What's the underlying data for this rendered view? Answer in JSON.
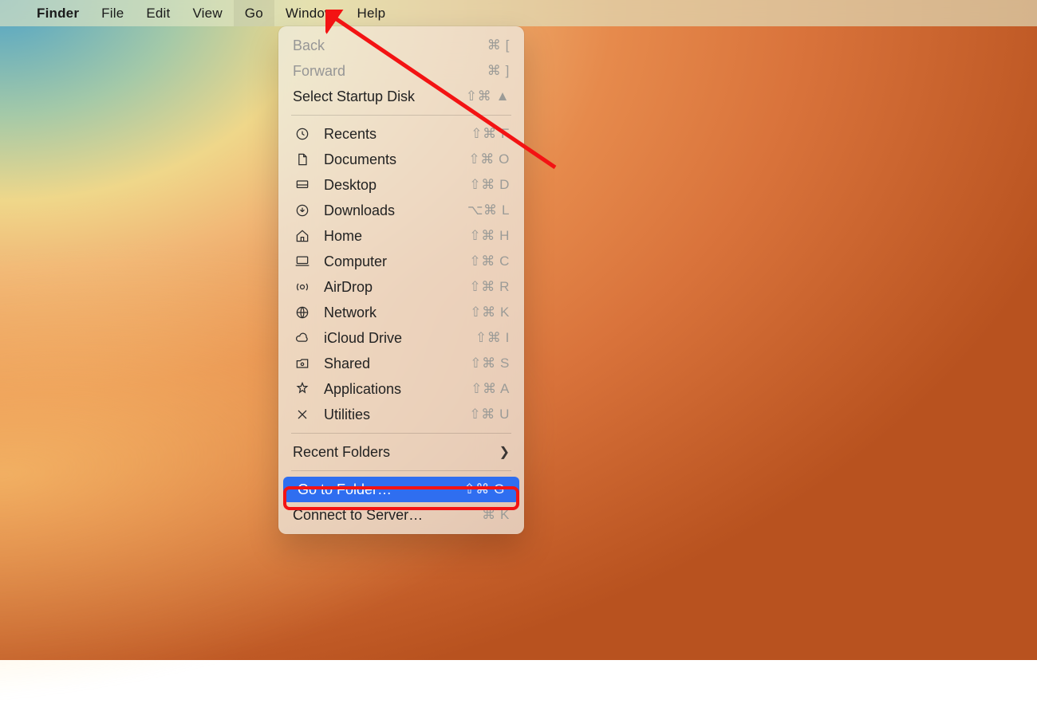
{
  "menubar": {
    "app_name": "Finder",
    "items": [
      "File",
      "Edit",
      "View",
      "Go",
      "Window",
      "Help"
    ],
    "activeIndex": 3
  },
  "dropdown": {
    "sections": [
      {
        "rows": [
          {
            "label": "Back",
            "shortcut": "⌘ [",
            "disabled": true,
            "icon": null
          },
          {
            "label": "Forward",
            "shortcut": "⌘ ]",
            "disabled": true,
            "icon": null
          },
          {
            "label": "Select Startup Disk",
            "shortcut": "⇧⌘ ▲",
            "disabled": false,
            "icon": null
          }
        ]
      },
      {
        "rows": [
          {
            "label": "Recents",
            "shortcut": "⇧⌘ F",
            "icon": "clock-icon"
          },
          {
            "label": "Documents",
            "shortcut": "⇧⌘ O",
            "icon": "document-icon"
          },
          {
            "label": "Desktop",
            "shortcut": "⇧⌘ D",
            "icon": "desktop-icon"
          },
          {
            "label": "Downloads",
            "shortcut": "⌥⌘ L",
            "icon": "download-icon"
          },
          {
            "label": "Home",
            "shortcut": "⇧⌘ H",
            "icon": "home-icon"
          },
          {
            "label": "Computer",
            "shortcut": "⇧⌘ C",
            "icon": "computer-icon"
          },
          {
            "label": "AirDrop",
            "shortcut": "⇧⌘ R",
            "icon": "airdrop-icon"
          },
          {
            "label": "Network",
            "shortcut": "⇧⌘ K",
            "icon": "network-icon"
          },
          {
            "label": "iCloud Drive",
            "shortcut": "⇧⌘ I",
            "icon": "cloud-icon"
          },
          {
            "label": "Shared",
            "shortcut": "⇧⌘ S",
            "icon": "shared-folder-icon"
          },
          {
            "label": "Applications",
            "shortcut": "⇧⌘ A",
            "icon": "applications-icon"
          },
          {
            "label": "Utilities",
            "shortcut": "⇧⌘ U",
            "icon": "utilities-icon"
          }
        ]
      },
      {
        "rows": [
          {
            "label": "Recent Folders",
            "submenu": true,
            "icon": null
          }
        ]
      },
      {
        "rows": [
          {
            "label": "Go to Folder…",
            "shortcut": "⇧⌘ G",
            "highlight": true,
            "icon": null,
            "annotated": true
          },
          {
            "label": "Connect to Server…",
            "shortcut": "⌘ K",
            "icon": null
          }
        ]
      }
    ]
  },
  "annotation": {
    "arrow_color": "#f31313",
    "box_color": "#f31313"
  }
}
